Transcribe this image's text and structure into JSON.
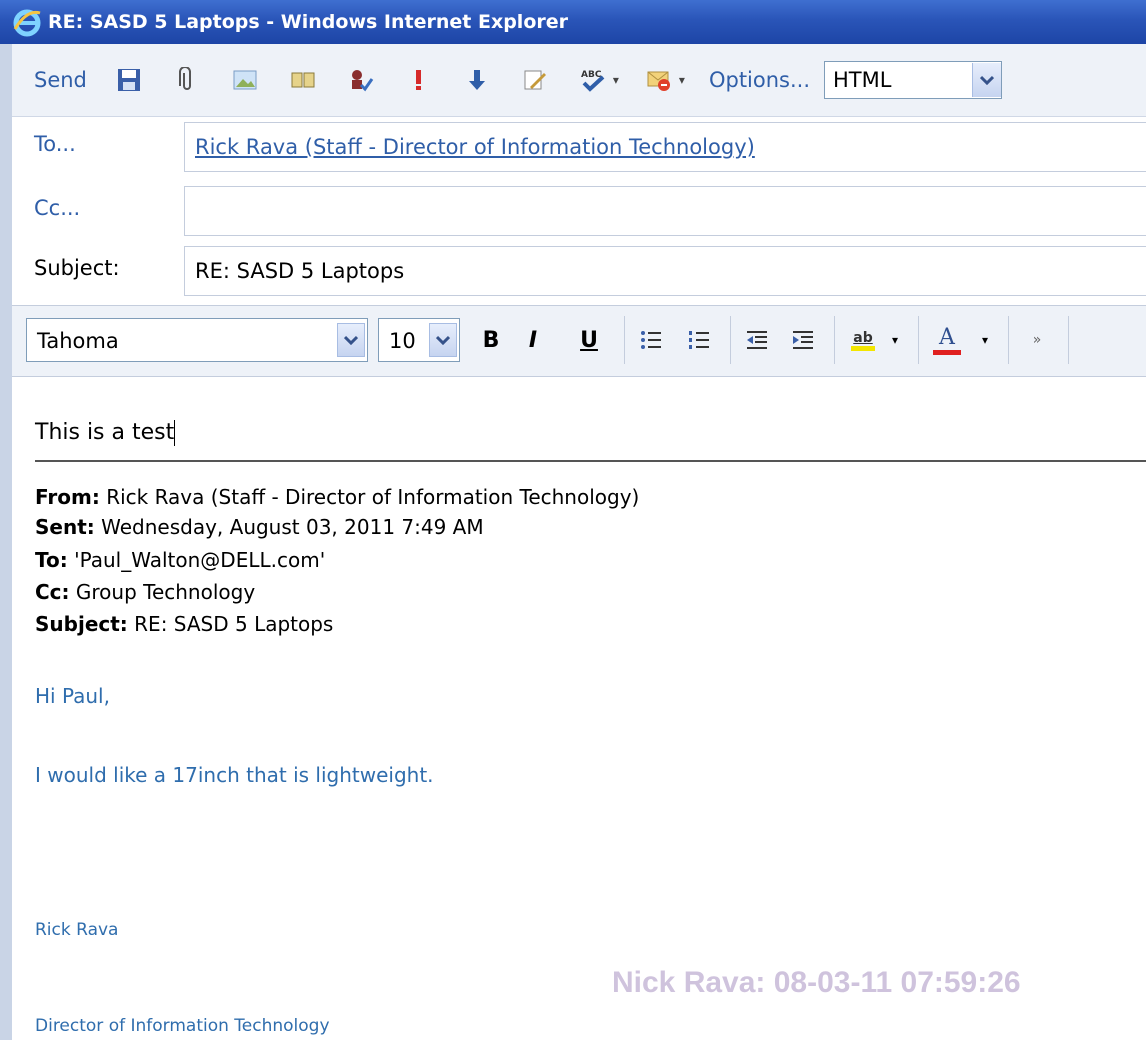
{
  "window": {
    "title": "RE: SASD 5 Laptops - Windows Internet Explorer"
  },
  "toolbar": {
    "send_label": "Send",
    "options_label": "Options...",
    "format_value": "HTML",
    "icons": [
      "save-icon",
      "attach-icon",
      "insert-image-icon",
      "address-book-icon",
      "check-names-icon",
      "high-importance-icon",
      "low-importance-icon",
      "signature-icon",
      "spelling-icon",
      "flag-icon"
    ]
  },
  "fields": {
    "to_label": "To...",
    "to_value": "Rick Rava (Staff - Director of Information Technology)",
    "cc_label": "Cc...",
    "cc_value": "",
    "subject_label": "Subject:",
    "subject_value": "RE: SASD 5 Laptops"
  },
  "format": {
    "font": "Tahoma",
    "size": "10",
    "bold": "B",
    "italic": "I",
    "underline": "U",
    "font_color_glyph": "A",
    "highlight_glyph": "ab"
  },
  "body": {
    "typed": "This is a test",
    "quoted": {
      "from_label": "From:",
      "from": "Rick Rava (Staff - Director of Information Technology)",
      "sent_label": "Sent:",
      "sent": "Wednesday, August 03, 2011 7:49 AM",
      "to_label": "To:",
      "to": "'Paul_Walton@DELL.com'",
      "cc_label": "Cc:",
      "cc": "Group Technology",
      "subject_label": "Subject:",
      "subject": "RE: SASD 5 Laptops"
    },
    "greeting": "Hi Paul,",
    "message": "I would like a 17inch that is lightweight.",
    "signature_name": "Rick Rava",
    "signature_title": "Director of Information Technology"
  },
  "watermark": "Nick Rava: 08-03-11 07:59:26"
}
